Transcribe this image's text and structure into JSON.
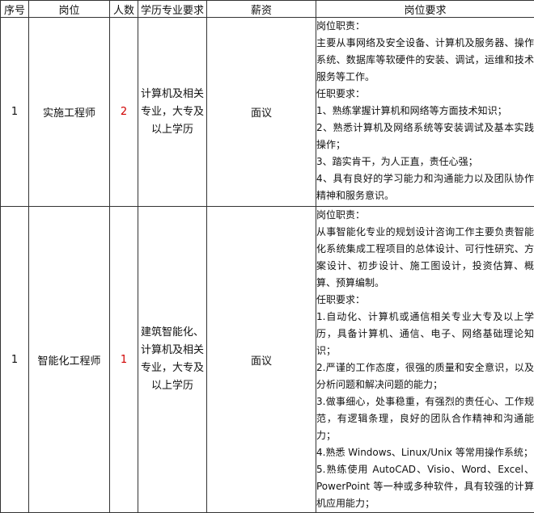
{
  "headers": [
    "序号",
    "岗位",
    "人数",
    "学历专业要求",
    "薪资",
    "岗位要求"
  ],
  "rows": [
    {
      "index": "1",
      "position": "实施工程师",
      "count": "2",
      "education": "计算机及相关专业，大专及以上学历",
      "salary": "面议",
      "requirements": [
        "岗位职责：",
        "主要从事网络及安全设备、计算机及服务器、操作系统、数据库等软硬件的安装、调试，运维和技术服务等工作。",
        "任职要求：",
        "1、熟练掌握计算机和网络等方面技术知识；",
        "2、熟悉计算机及网络系统等安装调试及基本实践操作；",
        "3、踏实肯干，为人正直，责任心强；",
        "4、具有良好的学习能力和沟通能力以及团队协作精神和服务意识。"
      ]
    },
    {
      "index": "1",
      "position": "智能化工程师",
      "count": "1",
      "education": "建筑智能化、计算机及相关专业，大专及以上学历",
      "salary": "面议",
      "requirements": [
        "岗位职责：",
        "从事智能化专业的规划设计咨询工作主要负责智能化系统集成工程项目的总体设计、可行性研究、方案设计、初步设计、施工图设计，投资估算、概算、预算编制。",
        "任职要求：",
        "1.自动化、计算机或通信相关专业大专及以上学历，具备计算机、通信、电子、网络基础理论知识；",
        "2.严谨的工作态度，很强的质量和安全意识，以及分析问题和解决问题的能力；",
        "3.做事细心，处事稳重，有强烈的责任心、工作规范，有逻辑条理，良好的团队合作精神和沟通能力；",
        "4.熟悉 Windows、Linux/Unix 等常用操作系统；",
        "5.熟练使用 AutoCAD、Visio、Word、Excel、PowerPoint 等一种或多种软件，具有较强的计算机应用能力；"
      ]
    }
  ]
}
